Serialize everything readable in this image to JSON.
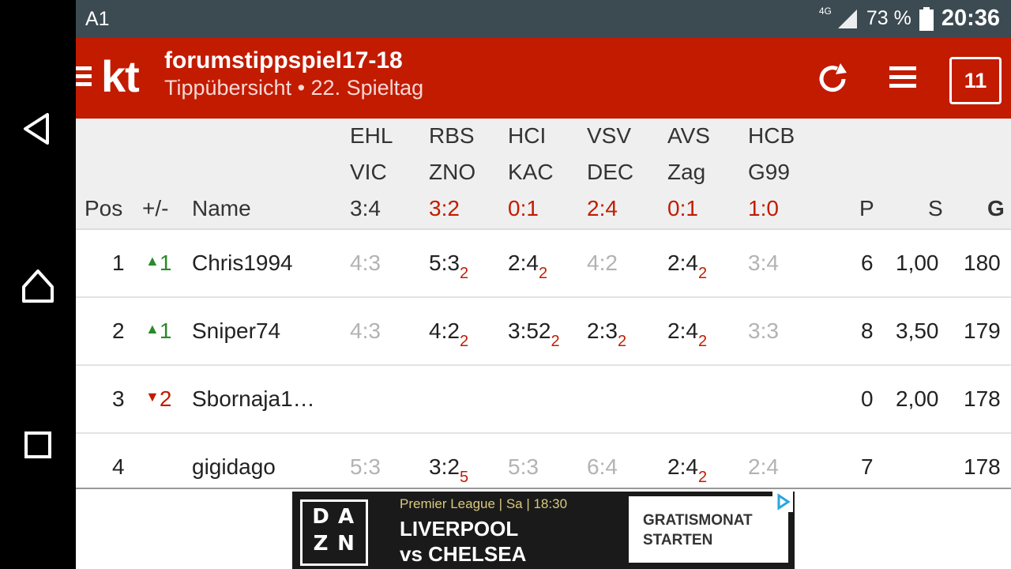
{
  "status": {
    "carrier": "A1",
    "network": "4G",
    "battery": "73 %",
    "time": "20:36"
  },
  "header": {
    "logo": "kt",
    "title": "forumstippspiel17-18",
    "subtitle": "Tippübersicht • 22. Spieltag",
    "day_badge": "11"
  },
  "table": {
    "pos_header": "Pos",
    "change_header": "+/-",
    "name_header": "Name",
    "games": [
      {
        "home": "EHL",
        "away": "VIC",
        "result": "3:4"
      },
      {
        "home": "RBS",
        "away": "ZNO",
        "result": "3:2"
      },
      {
        "home": "HCI",
        "away": "KAC",
        "result": "0:1"
      },
      {
        "home": "VSV",
        "away": "DEC",
        "result": "2:4"
      },
      {
        "home": "AVS",
        "away": "Zag",
        "result": "0:1"
      },
      {
        "home": "HCB",
        "away": "G99",
        "result": "1:0"
      }
    ],
    "p_header": "P",
    "s_header": "S",
    "g_header": "G",
    "rows": [
      {
        "pos": "1",
        "change": "1",
        "name": "Chris1994",
        "tips": [
          {
            "t": "4:3",
            "pts": ""
          },
          {
            "t": "5:3",
            "pts": "2"
          },
          {
            "t": "2:4",
            "pts": "2"
          },
          {
            "t": "4:2",
            "pts": ""
          },
          {
            "t": "2:4",
            "pts": "2"
          },
          {
            "t": "3:4",
            "pts": ""
          }
        ],
        "p": "6",
        "s": "1,00",
        "g": "180"
      },
      {
        "pos": "2",
        "change": "1",
        "name": "Sniper74",
        "tips": [
          {
            "t": "4:3",
            "pts": ""
          },
          {
            "t": "4:2",
            "pts": "2"
          },
          {
            "t": "3:52",
            "pts": "2"
          },
          {
            "t": "2:3",
            "pts": "2"
          },
          {
            "t": "2:4",
            "pts": "2"
          },
          {
            "t": "3:3",
            "pts": ""
          }
        ],
        "p": "8",
        "s": "3,50",
        "g": "179"
      },
      {
        "pos": "3",
        "change": "2",
        "name": "Sbornaja1…",
        "tips": [],
        "p": "0",
        "s": "2,00",
        "g": "178"
      },
      {
        "pos": "4",
        "change": "",
        "name": "gigidago",
        "tips": [
          {
            "t": "5:3",
            "pts": ""
          },
          {
            "t": "3:2",
            "pts": "5"
          },
          {
            "t": "5:3",
            "pts": ""
          },
          {
            "t": "6:4",
            "pts": ""
          },
          {
            "t": "2:4",
            "pts": "2"
          },
          {
            "t": "2:4",
            "pts": ""
          }
        ],
        "p": "7",
        "s": "",
        "g": "178"
      }
    ]
  },
  "ad": {
    "top_line": "Premier League | Sa | 18:30",
    "line1": "LIVERPOOL",
    "line2": "vs CHELSEA",
    "cta_line1": "GRATISMONAT",
    "cta_line2": "STARTEN",
    "brand": "DAZN"
  },
  "colors": {
    "brand_red": "#c21b00",
    "statusbar": "#3c4a52",
    "up": "#2a8a2a",
    "down": "#c21b00"
  }
}
